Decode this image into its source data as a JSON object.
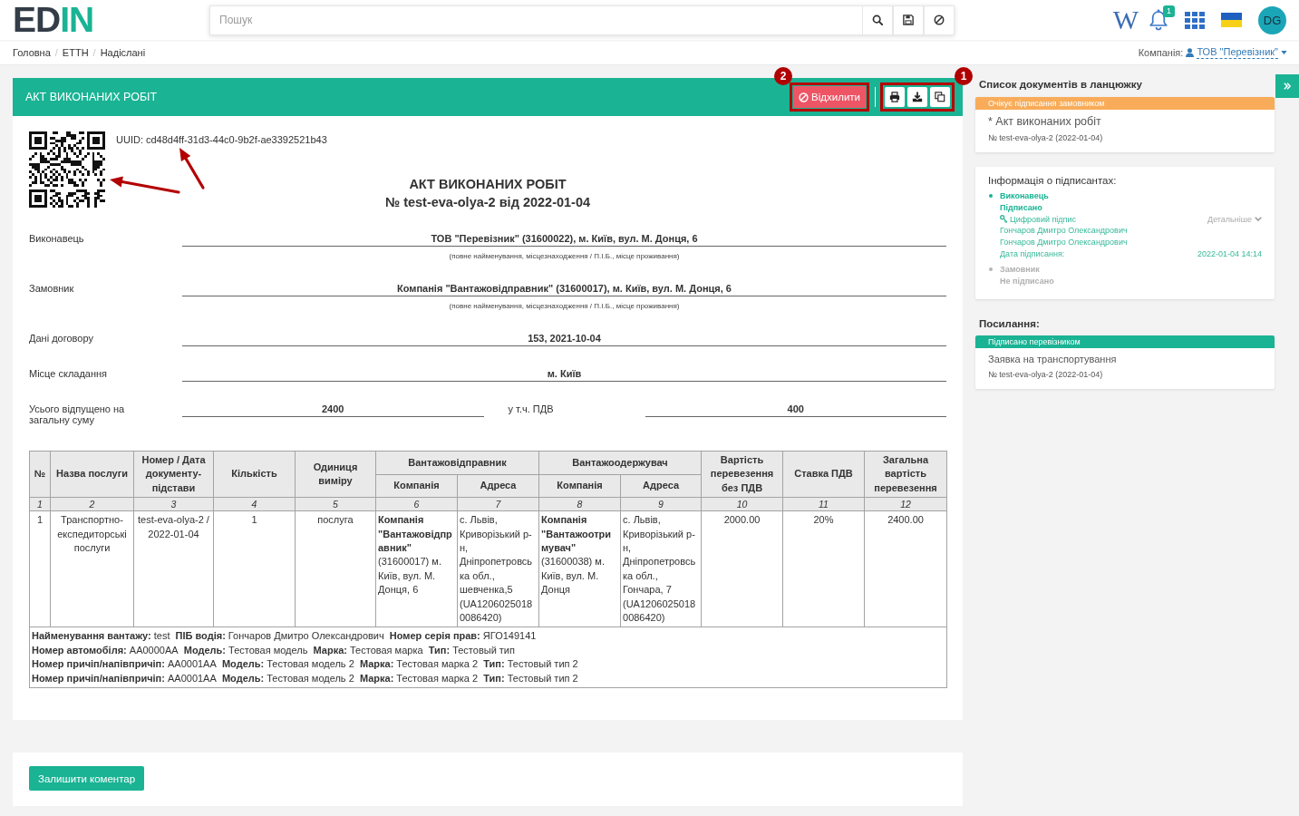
{
  "header": {
    "logo": {
      "part_1": "ED",
      "part_2": "IN"
    },
    "search": {
      "placeholder": "Пошук"
    },
    "wiki_button": "W",
    "notification_count": "1",
    "avatar_initials": "DG"
  },
  "breadcrumb": {
    "separator": "/",
    "items": [
      "Головна",
      "ЕТТН",
      "Надіслані"
    ]
  },
  "company": {
    "label": "Компанія:",
    "value": "ТОВ \"Перевізник\""
  },
  "document": {
    "title_bar": "АКТ ВИКОНАНИХ РОБІТ",
    "reject_button": "Відхилити",
    "callouts": [
      "2",
      "1"
    ],
    "uuid": "UUID: cd48d4ff-31d3-44c0-9b2f-ae3392521b43",
    "title": "АКТ ВИКОНАНИХ РОБІТ",
    "subtitle": "№ test-eva-olya-2 від 2022-01-04",
    "fields": [
      {
        "kind": "single",
        "label": "Виконавець",
        "value": "ТОВ \"Перевізник\" (31600022), м. Київ, вул. М. Донця, 6",
        "hint": "(повне найменування, місцезнаходження / П.І.Б., місце проживання)"
      },
      {
        "kind": "single",
        "label": "Замовник",
        "value": "Компанія \"Вантажовідправник\" (31600017), м. Київ, вул. М. Донця, 6",
        "hint": "(повне найменування, місцезнаходження / П.І.Б., місце проживання)"
      },
      {
        "kind": "single",
        "label": "Дані договору",
        "value": "153, 2021-10-04"
      },
      {
        "kind": "single",
        "label": "Місце складання",
        "value": "м. Київ"
      },
      {
        "kind": "pair",
        "label": "Усього відпущено на загальну суму",
        "value": "2400",
        "label_2": "у т.ч. ПДВ",
        "value_2": "400"
      }
    ],
    "table": {
      "columns": [
        {
          "label": "№"
        },
        {
          "label": "Назва послуги"
        },
        {
          "label": "Номер / Дата документу-підстави"
        },
        {
          "label": "Кількість"
        },
        {
          "label": "Одиниця виміру"
        },
        {
          "label": "Вантажовідправник",
          "colspan": 2,
          "children": [
            {
              "label": "Компанія"
            },
            {
              "label": "Адреса"
            }
          ]
        },
        {
          "label": "Вантажоодержувач",
          "colspan": 2,
          "children": [
            {
              "label": "Компанія"
            },
            {
              "label": "Адреса"
            }
          ]
        },
        {
          "label": "Вартість перевезення без ПДВ"
        },
        {
          "label": "Ставка ПДВ"
        },
        {
          "label": "Загальна вартість перевезення"
        }
      ],
      "column_numbers": [
        "1",
        "2",
        "3",
        "4",
        "5",
        "6",
        "7",
        "8",
        "9",
        "10",
        "11",
        "12"
      ],
      "rows": [
        {
          "cells": [
            "1",
            "Транспортно-експедиторські послуги",
            "test-eva-olya-2 / 2022-01-04",
            "1",
            "послуга",
            "**Компанія \"Вантажовідправник\"** (31600017) м. Київ, вул. М. Донця, 6",
            "с. Львів, Криворізький р-н, Дніпропетровська обл., шевченка,5 (UA12060250180086420)",
            "**Компанія \"Вантажоотримувач\"** (31600038) м. Київ, вул. М. Донця",
            "с. Львів, Криворізький р-н, Дніпропетровська обл., Гончара, 7 (UA12060250180086420)",
            "2000.00",
            "20%",
            "2400.00"
          ]
        }
      ],
      "notes": [
        "**Найменування вантажу:** test  **ПІБ водія:** Гончаров Дмитро Олександрович  **Номер серія прав:** ЯГО149141",
        "**Номер автомобіля:** АА0000АА  **Модель:** Тестовая модель  **Марка:** Тестовая марка  **Тип:** Тестовый тип",
        "**Номер причіп/напівпричіп:** АА0001АА  **Модель:** Тестовая модель 2  **Марка:** Тестовая марка 2  **Тип:** Тестовый тип 2",
        "**Номер причіп/напівпричіп:** АА0001АА  **Модель:** Тестовая модель 2  **Марка:** Тестовая марка 2  **Тип:** Тестовый тип 2"
      ]
    }
  },
  "comment_button": "Залишити коментар",
  "sidebar": {
    "chain": {
      "title": "Список документів в ланцюжку",
      "documents": [
        {
          "status": "Очікує підписання замовником",
          "color": "#f8ac59",
          "current": true,
          "title": "* Акт виконаних робіт",
          "number": "№ test-eva-olya-2 (2022-01-04)"
        }
      ]
    },
    "signers": {
      "title": "Інформація о підписантах:",
      "items": [
        {
          "role": "Виконавець",
          "status": "Підписано",
          "signed": true,
          "details": {
            "signature": "Цифровий підпис",
            "more": "Детальніше",
            "names": [
              "Гончаров Дмитро Олександрович",
              "Гончаров Дмитро Олександрович"
            ],
            "date_label": "Дата підписання:",
            "date": "2022-01-04 14:14"
          }
        },
        {
          "role": "Замовник",
          "status": "Не підписано",
          "signed": false
        }
      ]
    },
    "links": {
      "title": "Посилання:",
      "documents": [
        {
          "status": "Підписано перевізником",
          "color": "#1ab394",
          "current": false,
          "title": "Заявка на транспортування",
          "number": "№ test-eva-olya-2 (2022-01-04)"
        }
      ]
    }
  }
}
